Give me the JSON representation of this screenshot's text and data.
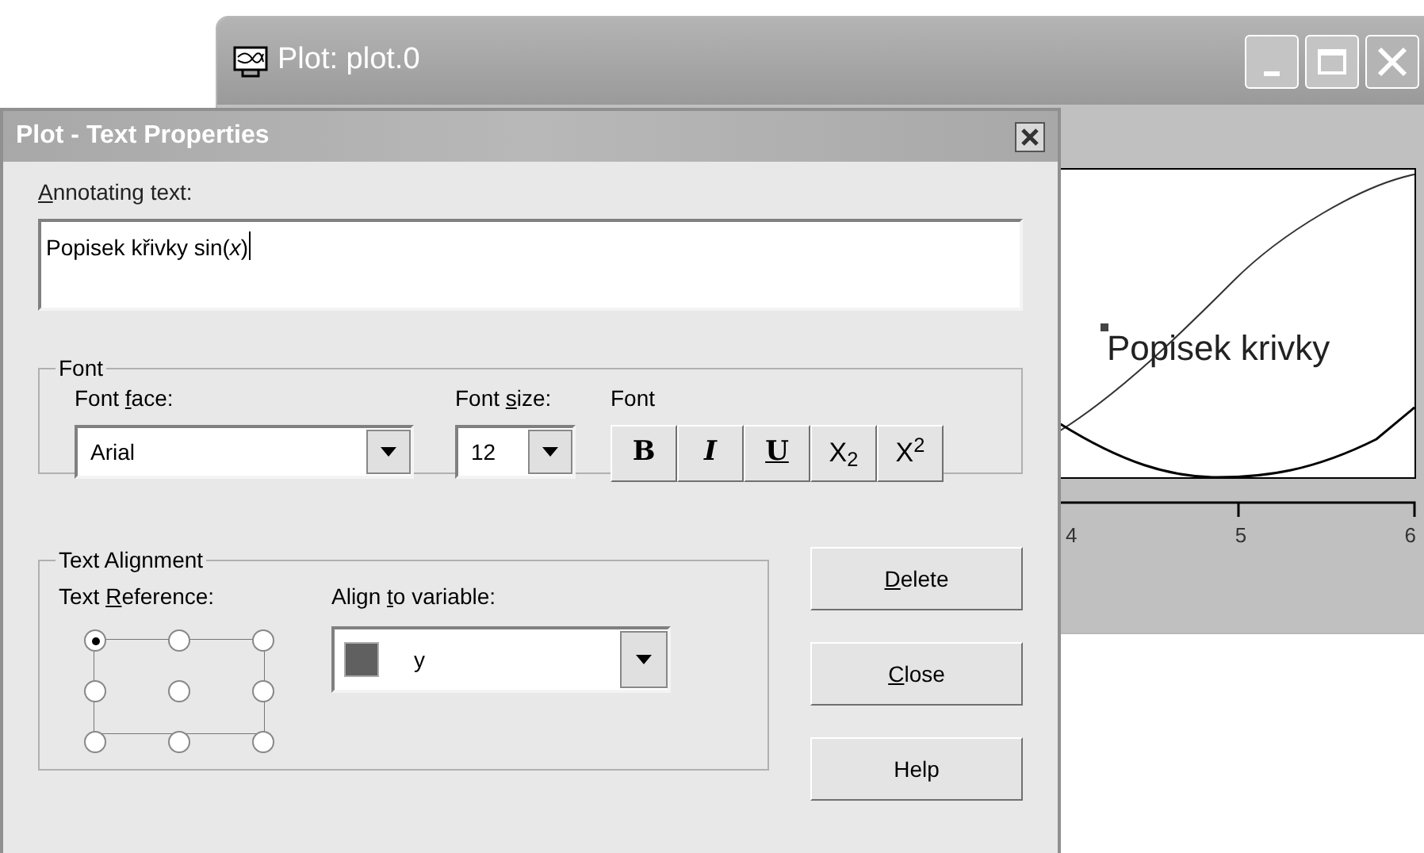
{
  "plot_window": {
    "title": "Plot: plot.0",
    "annotation": "Popisek krivky",
    "x_tick_labels": [
      "4",
      "5",
      "6"
    ]
  },
  "dialog": {
    "title": "Plot - Text Properties",
    "annotating_label": {
      "key": "A",
      "after": "nnotating text:"
    },
    "annotating_value": "Popisek křivky sin(*x*)",
    "font_group": {
      "title": "Font",
      "face_label": {
        "before": "Font ",
        "key": "f",
        "after": "ace:"
      },
      "face_value": "Arial",
      "size_label": {
        "before": "Font ",
        "key": "s",
        "after": "ize:"
      },
      "size_value": "12",
      "style_label": "Font",
      "style_buttons": [
        {
          "kind": "bold",
          "label": "B"
        },
        {
          "kind": "italic",
          "label": "I"
        },
        {
          "kind": "underline",
          "label": "U"
        },
        {
          "kind": "subscript",
          "label": "X$_{2}$"
        },
        {
          "kind": "superscript",
          "label": "X$^{2}$"
        }
      ]
    },
    "alignment_group": {
      "title": "Text Alignment",
      "reference_label": {
        "before": "Text ",
        "key": "R",
        "after": "eference:"
      },
      "reference_points": [
        {
          "selected": true
        },
        {
          "selected": false
        },
        {
          "selected": false
        },
        {
          "selected": false
        },
        {
          "selected": false
        },
        {
          "selected": false
        },
        {
          "selected": false
        },
        {
          "selected": false
        },
        {
          "selected": false
        }
      ],
      "variable_label": {
        "before": "Align ",
        "key": "t",
        "after": "o variable:"
      },
      "variable": {
        "name": "y",
        "color": "#606060"
      }
    },
    "buttons": [
      {
        "key": "D",
        "after": "elete"
      },
      {
        "key": "C",
        "after": "lose"
      },
      {
        "before": "Help"
      }
    ]
  }
}
